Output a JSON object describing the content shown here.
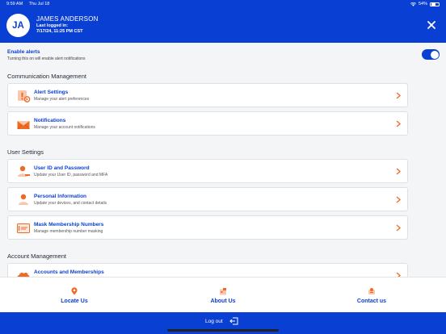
{
  "status_bar": {
    "time": "9:59 AM",
    "date": "Thu Jul 18",
    "battery": "54%"
  },
  "header": {
    "initials": "JA",
    "user_name": "JAMES ANDERSON",
    "last_logged_label": "Last logged in:",
    "last_logged_value": "7/17/24, 11:25 PM CST"
  },
  "alerts": {
    "title": "Enable alerts",
    "subtitle": "Turning this on will enable alert notifications",
    "enabled": true
  },
  "sections": {
    "communication": {
      "title": "Communication Management",
      "items": [
        {
          "title": "Alert Settings",
          "subtitle": "Manage your alert preferences",
          "icon": "alert-settings-icon"
        },
        {
          "title": "Notifications",
          "subtitle": "Manage your account notifications",
          "icon": "envelope-icon"
        }
      ]
    },
    "user": {
      "title": "User Settings",
      "items": [
        {
          "title": "User ID and Password",
          "subtitle": "Update your User ID, password and MFA",
          "icon": "user-key-icon"
        },
        {
          "title": "Personal Information",
          "subtitle": "Update your devices, and contact details",
          "icon": "person-icon"
        },
        {
          "title": "Mask Membership Numbers",
          "subtitle": "Manage membership number masking",
          "icon": "masked-card-icon"
        }
      ]
    },
    "account": {
      "title": "Account Management",
      "items": [
        {
          "title": "Accounts and Memberships",
          "subtitle": "",
          "icon": "cloud-icon"
        }
      ]
    }
  },
  "bottom_nav": [
    {
      "label": "Locate Us",
      "icon": "location-pin-icon"
    },
    {
      "label": "About Us",
      "icon": "info-building-icon"
    },
    {
      "label": "Contact us",
      "icon": "contact-icon"
    }
  ],
  "logout": {
    "label": "Log out",
    "icon": "logout-icon"
  },
  "colors": {
    "primary": "#0a3fd3",
    "accent": "#ef6b25",
    "background": "#f4f5f7"
  }
}
